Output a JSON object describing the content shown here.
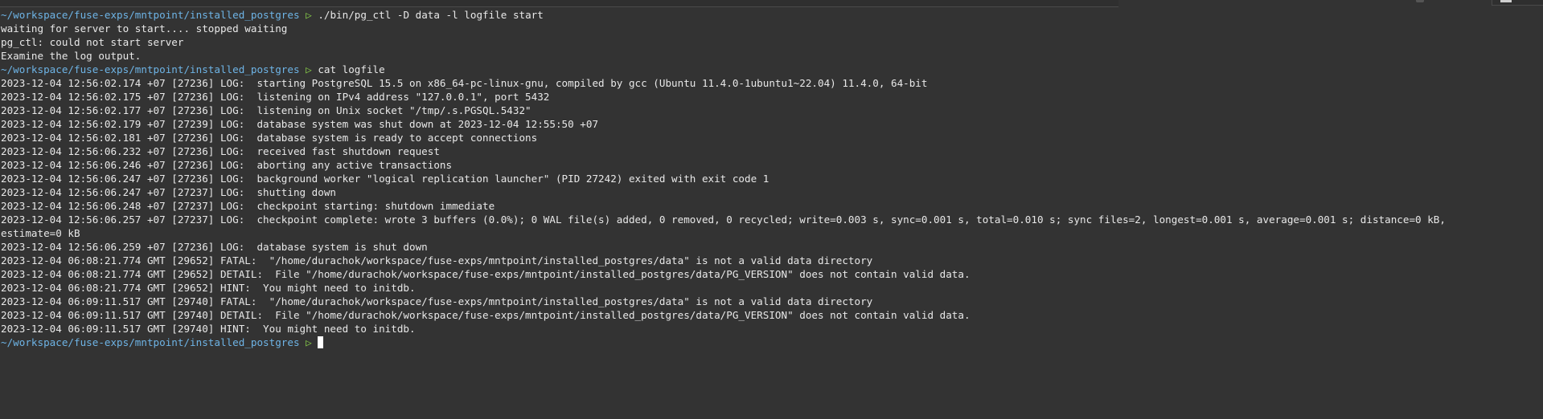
{
  "terminal": {
    "prompt": {
      "path": "~/workspace/fuse-exps/mntpoint/installed_postgres",
      "arrow": "▷"
    },
    "lines": [
      {
        "kind": "prompt",
        "cmd": "./bin/pg_ctl -D data -l logfile start"
      },
      {
        "kind": "out",
        "text": "waiting for server to start.... stopped waiting"
      },
      {
        "kind": "out",
        "text": "pg_ctl: could not start server"
      },
      {
        "kind": "out",
        "text": "Examine the log output."
      },
      {
        "kind": "prompt",
        "cmd": "cat logfile"
      },
      {
        "kind": "out",
        "text": "2023-12-04 12:56:02.174 +07 [27236] LOG:  starting PostgreSQL 15.5 on x86_64-pc-linux-gnu, compiled by gcc (Ubuntu 11.4.0-1ubuntu1~22.04) 11.4.0, 64-bit"
      },
      {
        "kind": "out",
        "text": "2023-12-04 12:56:02.175 +07 [27236] LOG:  listening on IPv4 address \"127.0.0.1\", port 5432"
      },
      {
        "kind": "out",
        "text": "2023-12-04 12:56:02.177 +07 [27236] LOG:  listening on Unix socket \"/tmp/.s.PGSQL.5432\""
      },
      {
        "kind": "out",
        "text": "2023-12-04 12:56:02.179 +07 [27239] LOG:  database system was shut down at 2023-12-04 12:55:50 +07"
      },
      {
        "kind": "out",
        "text": "2023-12-04 12:56:02.181 +07 [27236] LOG:  database system is ready to accept connections"
      },
      {
        "kind": "out",
        "text": "2023-12-04 12:56:06.232 +07 [27236] LOG:  received fast shutdown request"
      },
      {
        "kind": "out",
        "text": "2023-12-04 12:56:06.246 +07 [27236] LOG:  aborting any active transactions"
      },
      {
        "kind": "out",
        "text": "2023-12-04 12:56:06.247 +07 [27236] LOG:  background worker \"logical replication launcher\" (PID 27242) exited with exit code 1"
      },
      {
        "kind": "out",
        "text": "2023-12-04 12:56:06.247 +07 [27237] LOG:  shutting down"
      },
      {
        "kind": "out",
        "text": "2023-12-04 12:56:06.248 +07 [27237] LOG:  checkpoint starting: shutdown immediate"
      },
      {
        "kind": "out",
        "text": "2023-12-04 12:56:06.257 +07 [27237] LOG:  checkpoint complete: wrote 3 buffers (0.0%); 0 WAL file(s) added, 0 removed, 0 recycled; write=0.003 s, sync=0.001 s, total=0.010 s; sync files=2, longest=0.001 s, average=0.001 s; distance=0 kB,"
      },
      {
        "kind": "out",
        "text": "estimate=0 kB"
      },
      {
        "kind": "out",
        "text": "2023-12-04 12:56:06.259 +07 [27236] LOG:  database system is shut down"
      },
      {
        "kind": "out",
        "text": "2023-12-04 06:08:21.774 GMT [29652] FATAL:  \"/home/durachok/workspace/fuse-exps/mntpoint/installed_postgres/data\" is not a valid data directory"
      },
      {
        "kind": "out",
        "text": "2023-12-04 06:08:21.774 GMT [29652] DETAIL:  File \"/home/durachok/workspace/fuse-exps/mntpoint/installed_postgres/data/PG_VERSION\" does not contain valid data."
      },
      {
        "kind": "out",
        "text": "2023-12-04 06:08:21.774 GMT [29652] HINT:  You might need to initdb."
      },
      {
        "kind": "out",
        "text": "2023-12-04 06:09:11.517 GMT [29740] FATAL:  \"/home/durachok/workspace/fuse-exps/mntpoint/installed_postgres/data\" is not a valid data directory"
      },
      {
        "kind": "out",
        "text": "2023-12-04 06:09:11.517 GMT [29740] DETAIL:  File \"/home/durachok/workspace/fuse-exps/mntpoint/installed_postgres/data/PG_VERSION\" does not contain valid data."
      },
      {
        "kind": "out",
        "text": "2023-12-04 06:09:11.517 GMT [29740] HINT:  You might need to initdb."
      },
      {
        "kind": "prompt_cursor",
        "cmd": ""
      }
    ]
  },
  "colors": {
    "background": "#333333",
    "text": "#e8e8e8",
    "prompt_path": "#6eb4e6",
    "prompt_arrow": "#8bd44a",
    "cursor": "#ffffff"
  }
}
